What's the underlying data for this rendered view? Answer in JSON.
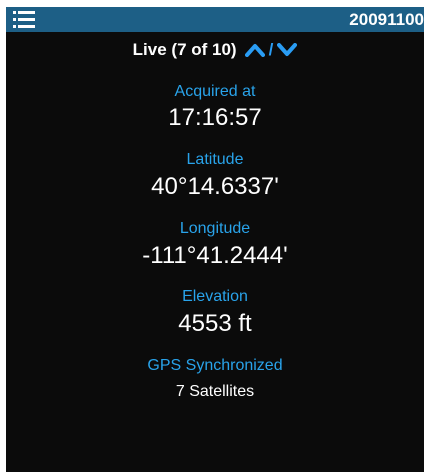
{
  "header": {
    "menu_icon": "list-menu-icon",
    "device_id": "20091100",
    "bar_color": "#1d5f86"
  },
  "nav": {
    "label": "Live (7 of 10)",
    "up_icon": "chevron-up-icon",
    "separator": "/",
    "down_icon": "chevron-down-icon",
    "accent_color": "#2a9df4"
  },
  "fields": {
    "acquired": {
      "label": "Acquired at",
      "value": "17:16:57"
    },
    "latitude": {
      "label": "Latitude",
      "value": "40°14.6337'"
    },
    "longitude": {
      "label": "Longitude",
      "value": "-111°41.2444'"
    },
    "elevation": {
      "label": "Elevation",
      "value": "4553 ft"
    },
    "gps": {
      "label": "GPS Synchronized",
      "value": "7 Satellites"
    }
  },
  "colors": {
    "background": "#0b0b0b",
    "label": "#29a3ea",
    "value": "#ffffff"
  }
}
